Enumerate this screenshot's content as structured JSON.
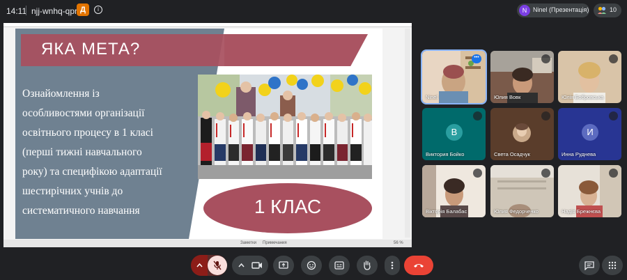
{
  "topbar": {
    "time": "14:11",
    "meeting_code": "njj-wnhq-qpr",
    "badge_letter": "Д",
    "info_symbol": "i",
    "presenter_initial": "N",
    "presenter_label": "Ninel (Презентація)",
    "participant_count": "10"
  },
  "slide": {
    "title": "ЯКА   МЕТА?",
    "body_lines": [
      "Ознайомлення  із",
      "особливостями організації",
      "освітнього процесу в  1 класі",
      "(перші тижні навчального",
      "року) та  специфікою адаптації",
      "шестирічних учнів до",
      "систематичного навчання"
    ],
    "oval_text": "1 КЛАС",
    "photo_icon": "school-children-photo",
    "status_notes": "Заметки",
    "status_comments": "Примечания",
    "status_zoom": "56 %"
  },
  "tiles": [
    {
      "name": "Ninel",
      "kind": "video",
      "accent": "#e8d6c3"
    },
    {
      "name": "Юлия Вовк",
      "kind": "video",
      "accent": "#7a5a4a"
    },
    {
      "name": "Юлія Бобровська",
      "kind": "video",
      "accent": "#d9c4a8"
    },
    {
      "name": "Виктория Бойко",
      "kind": "avatar",
      "letter": "В",
      "bg": "#006a6b",
      "circle": "#2a9ea0"
    },
    {
      "name": "Света Осадчук",
      "kind": "photo-avatar",
      "bg": "#5a3d2b",
      "circle": "#c9a98a"
    },
    {
      "name": "Инна Руднева",
      "kind": "avatar",
      "letter": "И",
      "bg": "#283593",
      "circle": "#5c6bc0"
    },
    {
      "name": "Вікторія Балабас",
      "kind": "video",
      "accent": "#a0826d"
    },
    {
      "name": "Юлия Федорченко",
      "kind": "video",
      "accent": "#cfc6b8"
    },
    {
      "name": "Надія Брежнєва",
      "kind": "video",
      "accent": "#b59a86"
    }
  ],
  "colors": {
    "background": "#202124",
    "control": "#3c4043",
    "hangup": "#ea4335",
    "mic_off_bg": "#f9dedc",
    "slide_accent": "#a8505f",
    "slide_side": "#6f8191"
  },
  "controls": {
    "mic_toggle_icon": "chevron-up-icon",
    "mic_icon": "mic-off-icon",
    "camera_options_icon": "chevron-up-icon",
    "camera_icon": "camera-icon",
    "present_icon": "present-screen-icon",
    "emoji_icon": "emoji-icon",
    "captions_icon": "captions-icon",
    "hand_icon": "raise-hand-icon",
    "more_icon": "more-vert-icon",
    "hangup_icon": "call-end-icon",
    "chat_icon": "chat-icon",
    "activities_icon": "apps-grid-icon"
  }
}
